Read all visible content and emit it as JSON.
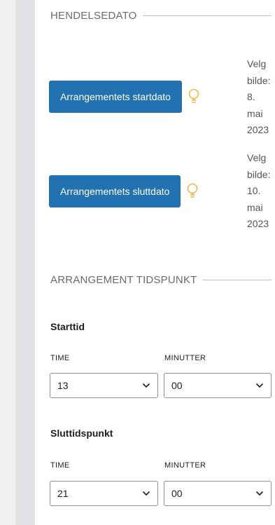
{
  "event_date": {
    "heading": "HENDELSEDATO",
    "start_button": "Arrangementets startdato",
    "start_note": [
      "Velg",
      "bilde:",
      "8.",
      "mai",
      "2023"
    ],
    "end_button": "Arrangementets sluttdato",
    "end_note": [
      "Velg",
      "bilde:",
      "10.",
      "mai",
      "2023"
    ]
  },
  "event_time": {
    "heading": "ARRANGEMENT TIDSPUNKT",
    "start": {
      "label": "Starttid",
      "hour_label": "TIME",
      "minute_label": "MINUTTER",
      "hour_value": "13",
      "minute_value": "00"
    },
    "end": {
      "label": "Sluttidspunkt",
      "hour_label": "TIME",
      "minute_label": "MINUTTER",
      "hour_value": "21",
      "minute_value": "00"
    }
  },
  "colors": {
    "button_bg": "#2271b1",
    "bulb": "#f0b849"
  },
  "icons": {
    "bulb": "lightbulb-icon",
    "chevron": "chevron-down-icon"
  }
}
